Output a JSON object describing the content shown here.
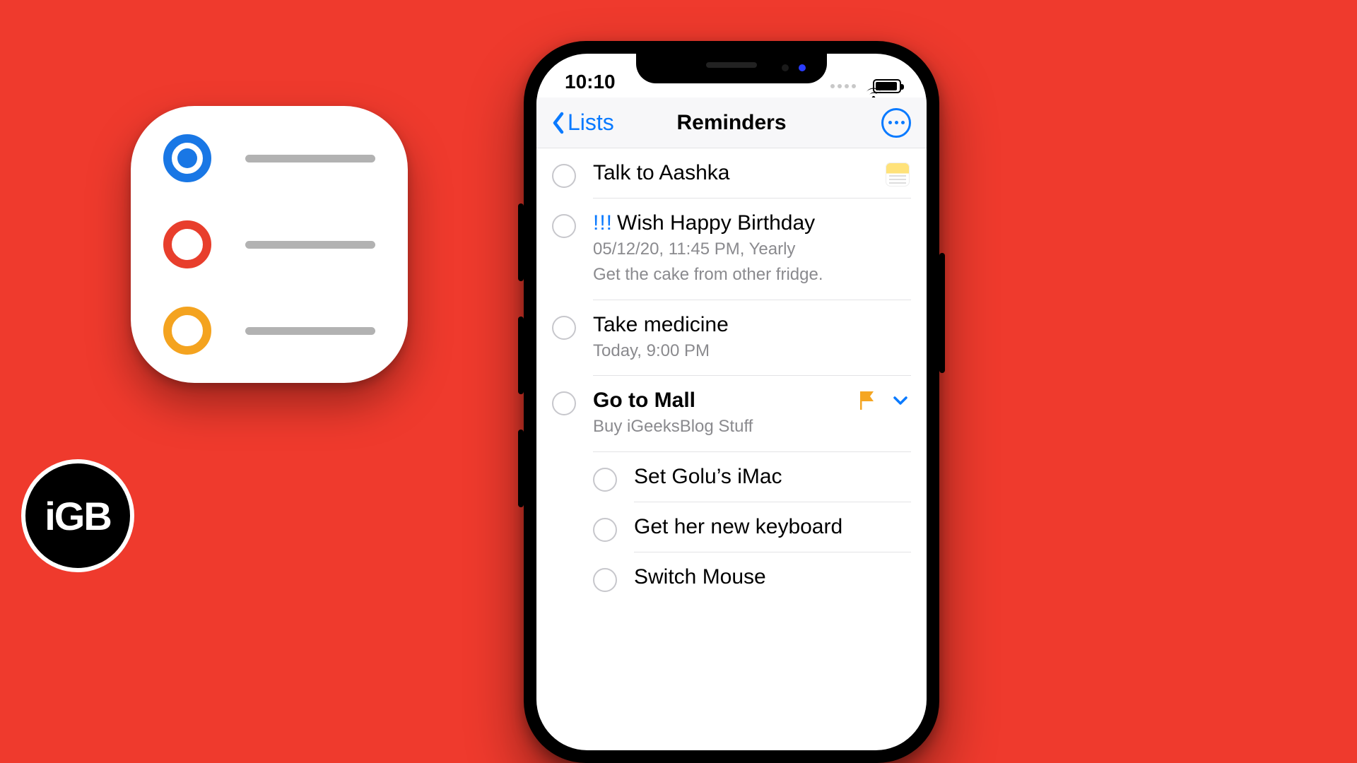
{
  "brand": {
    "badge_text": "iGB"
  },
  "app_icon": {
    "dots": [
      "#1977e5",
      "#e83e2c",
      "#f4a31f"
    ]
  },
  "status": {
    "time": "10:10"
  },
  "nav": {
    "back_label": "Lists",
    "title": "Reminders"
  },
  "reminders": [
    {
      "id": "talk-aashka",
      "title": "Talk to Aashka",
      "accessory": "notes"
    },
    {
      "id": "wish-birthday",
      "priority": "!!!",
      "title": "Wish Happy Birthday",
      "meta_date": "05/12/20, 11:45 PM, Yearly",
      "meta_note": "Get the cake from other fridge."
    },
    {
      "id": "take-medicine",
      "title": "Take medicine",
      "meta_date": "Today, 9:00 PM"
    },
    {
      "id": "go-mall",
      "title": "Go to Mall",
      "title_bold": true,
      "meta_note": "Buy iGeeksBlog Stuff",
      "accessory": "flag-expand",
      "subtasks": [
        {
          "id": "set-imac",
          "title": "Set Golu’s iMac"
        },
        {
          "id": "new-keyboard",
          "title": "Get her new keyboard"
        },
        {
          "id": "switch-mouse",
          "title": "Switch Mouse"
        }
      ]
    }
  ]
}
